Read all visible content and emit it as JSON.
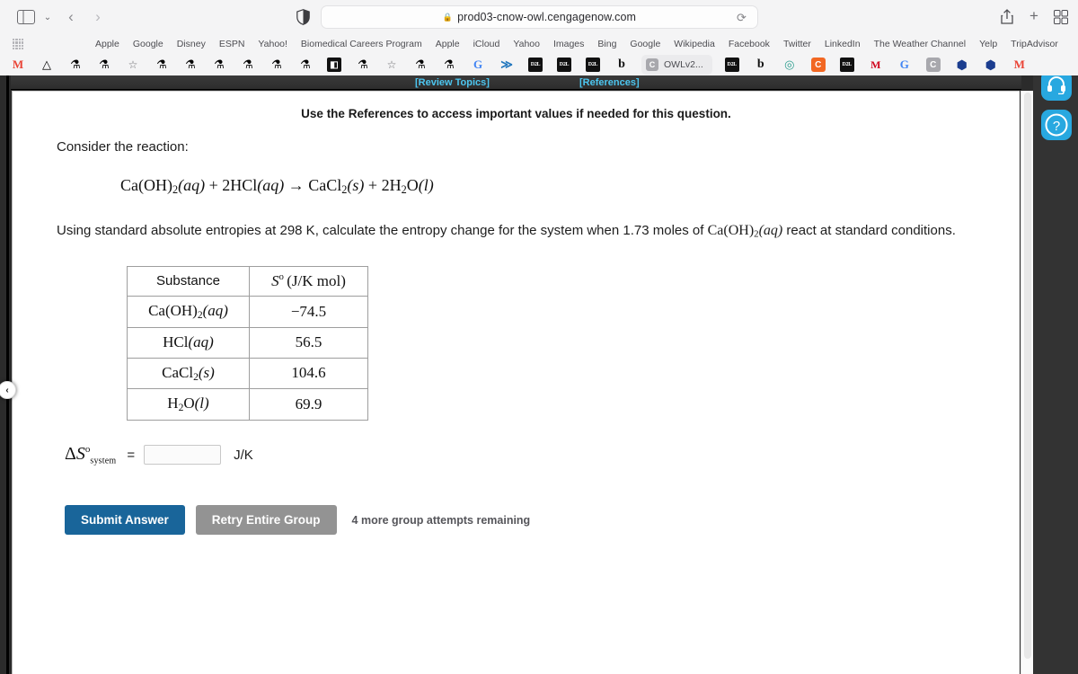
{
  "browser": {
    "url": "prod03-cnow-owl.cengagenow.com",
    "lock_icon": "lock-icon",
    "sidebar_icon": "sidebar-toggle-icon",
    "back_icon": "‹",
    "forward_icon": "›",
    "chevron_icon": "⌄",
    "reload_icon": "⟳",
    "share_icon": "share-icon",
    "newtab_icon": "+",
    "tabs_overview_icon": "tab-overview-icon",
    "bookmarks": [
      "Apple",
      "Google",
      "Disney",
      "ESPN",
      "Yahoo!",
      "Biomedical Careers Program",
      "Apple",
      "iCloud",
      "Yahoo",
      "Images",
      "Bing",
      "Google",
      "Wikipedia",
      "Facebook",
      "Twitter",
      "LinkedIn",
      "The Weather Channel",
      "Yelp",
      "TripAdvisor"
    ],
    "active_tab": {
      "title": "OWLv2...",
      "favicon_letter": "C"
    },
    "favicons_left": [
      {
        "name": "gmail-favicon",
        "glyph": "M",
        "cls": "fav-gmail"
      },
      {
        "name": "google-drive-favicon",
        "glyph": "△",
        "cls": "fav-drive"
      },
      {
        "name": "lab-favicon",
        "glyph": "⚗",
        "cls": "fav-lab"
      },
      {
        "name": "lab-favicon",
        "glyph": "⚗",
        "cls": "fav-lab"
      },
      {
        "name": "bookmark-star-favicon",
        "glyph": "☆",
        "cls": "fav-star"
      },
      {
        "name": "lab-favicon",
        "glyph": "⚗",
        "cls": "fav-lab"
      },
      {
        "name": "lab-favicon",
        "glyph": "⚗",
        "cls": "fav-lab"
      },
      {
        "name": "lab-favicon",
        "glyph": "⚗",
        "cls": "fav-lab"
      },
      {
        "name": "lab-favicon",
        "glyph": "⚗",
        "cls": "fav-lab"
      },
      {
        "name": "lab-favicon",
        "glyph": "⚗",
        "cls": "fav-lab"
      },
      {
        "name": "lab-favicon",
        "glyph": "⚗",
        "cls": "fav-lab"
      },
      {
        "name": "evernote-favicon",
        "glyph": "◧",
        "cls": "fav-evernote"
      },
      {
        "name": "lab-favicon",
        "glyph": "⚗",
        "cls": "fav-lab"
      },
      {
        "name": "bookmark-star-favicon",
        "glyph": "☆",
        "cls": "fav-star"
      },
      {
        "name": "lab-favicon",
        "glyph": "⚗",
        "cls": "fav-lab"
      },
      {
        "name": "lab-favicon",
        "glyph": "⚗",
        "cls": "fav-lab"
      },
      {
        "name": "google-favicon",
        "glyph": "G",
        "cls": "fav-g"
      },
      {
        "name": "squiggle-favicon",
        "glyph": "≫",
        "cls": "fav-squiggle"
      },
      {
        "name": "d2l-favicon",
        "glyph": "D2L",
        "cls": "fav-dark"
      },
      {
        "name": "d2l-favicon",
        "glyph": "D2L",
        "cls": "fav-dark"
      },
      {
        "name": "d2l-favicon",
        "glyph": "D2L",
        "cls": "fav-dark"
      },
      {
        "name": "blackboard-favicon",
        "glyph": "b",
        "cls": "fav-b"
      }
    ],
    "favicons_right": [
      {
        "name": "d2l-favicon",
        "glyph": "D2L",
        "cls": "fav-dark"
      },
      {
        "name": "blackboard-favicon",
        "glyph": "b",
        "cls": "fav-b"
      },
      {
        "name": "teal-circle-favicon",
        "glyph": "◎",
        "cls": "fav-teal"
      },
      {
        "name": "cengage-favicon",
        "glyph": "C",
        "cls": "fav-orange"
      },
      {
        "name": "d2l-favicon",
        "glyph": "D2L",
        "cls": "fav-dark"
      },
      {
        "name": "mcgraw-hill-favicon",
        "glyph": "M",
        "cls": "fav-red"
      },
      {
        "name": "google-favicon",
        "glyph": "G",
        "cls": "fav-g"
      },
      {
        "name": "cengage-gray-favicon",
        "glyph": "C",
        "cls": "fav-gray"
      },
      {
        "name": "shield-star-favicon",
        "glyph": "⬢",
        "cls": "fav-shield"
      },
      {
        "name": "shield-star-favicon",
        "glyph": "⬢",
        "cls": "fav-shield"
      },
      {
        "name": "gmail-favicon",
        "glyph": "M",
        "cls": "fav-gmail"
      }
    ]
  },
  "page": {
    "topic_links": {
      "review_topics": "[Review Topics]",
      "references": "[References]"
    },
    "references_note": "Use the References to access important values if needed for this question.",
    "consider_line": "Consider the reaction:",
    "reaction_equation": "Ca(OH)2(aq) + 2HCl(aq) → CaCl2(s) + 2H2O(l)",
    "question_prefix": "Using standard absolute entropies at 298 K, calculate the entropy change for the system when 1.73 moles of ",
    "question_species": "Ca(OH)2(aq)",
    "question_suffix": " react at standard conditions.",
    "table": {
      "headers": [
        "Substance",
        "S° (J/K mol)"
      ],
      "rows": [
        {
          "substance": "Ca(OH)2(aq)",
          "value": "−74.5"
        },
        {
          "substance": "HCl(aq)",
          "value": "56.5"
        },
        {
          "substance": "CaCl2(s)",
          "value": "104.6"
        },
        {
          "substance": "H2O(l)",
          "value": "69.9"
        }
      ]
    },
    "answer": {
      "symbol_delta": "ΔS",
      "symbol_sup": "o",
      "symbol_sub": "system",
      "equals": "=",
      "input_value": "",
      "input_placeholder": "",
      "units": "J/K"
    },
    "buttons": {
      "submit": "Submit Answer",
      "retry": "Retry Entire Group",
      "attempts": "4 more group attempts remaining"
    },
    "rail_collapse_icon": "‹",
    "helper_headset_icon": "headset-icon",
    "helper_question_icon": "?"
  },
  "colors": {
    "submit_blue": "#19659a",
    "retry_gray": "#939393",
    "link_blue": "#4cc6f0",
    "helper_blue": "#28a8e0",
    "dark_panel": "#333333"
  }
}
